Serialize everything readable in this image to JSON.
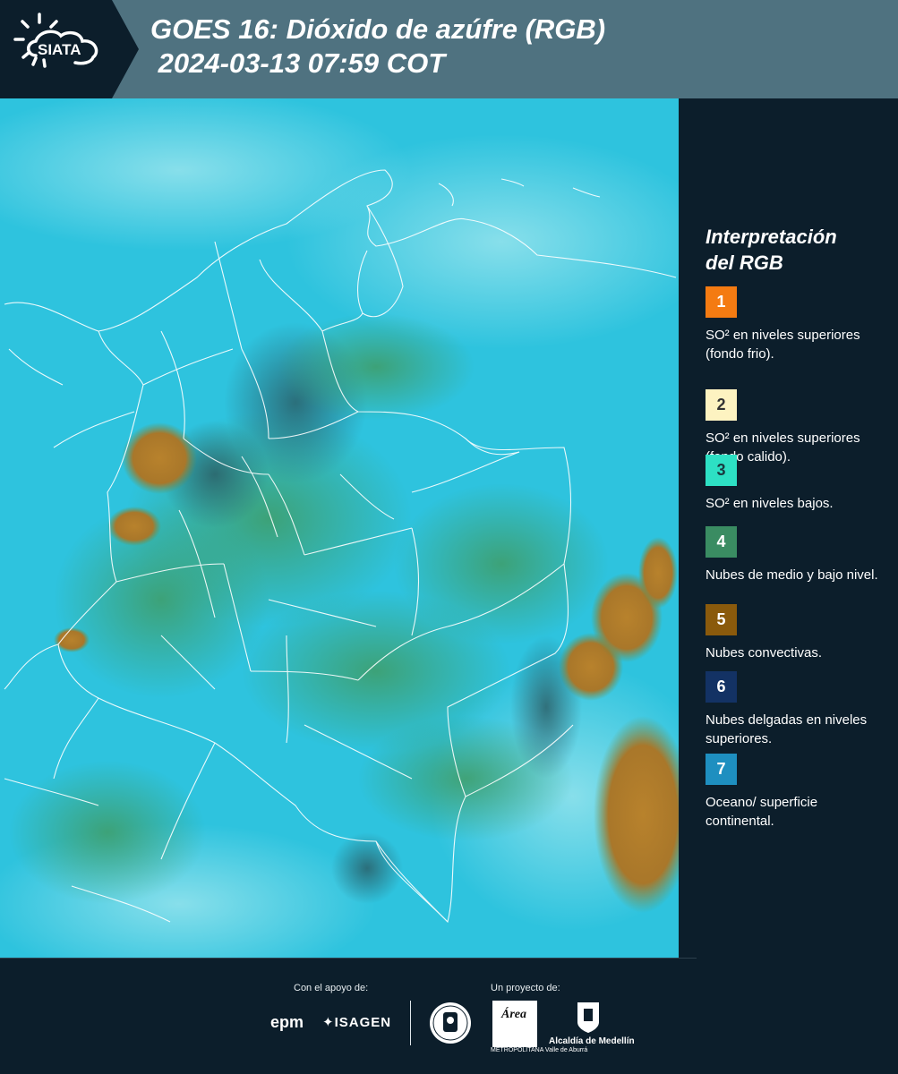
{
  "header": {
    "logo_text": "SIATA",
    "title_line1": "GOES 16: Dióxido de azúfre (RGB)",
    "title_line2": " 2024-03-13 07:59 COT",
    "background_color": "#4f7280",
    "logo_panel_color": "#0c1e2b"
  },
  "legend": {
    "title_line1": "Interpretación",
    "title_line2": "del RGB",
    "items": [
      {
        "number": "1",
        "color": "#f47b12",
        "number_color": "#ffffff",
        "description": "SO² en niveles superiores (fondo frio)."
      },
      {
        "number": "2",
        "color": "#fdf3c1",
        "number_color": "#333333",
        "description": "SO² en niveles superiores (fondo calido)."
      },
      {
        "number": "3",
        "color": "#2de0c4",
        "number_color": "#1a3a40",
        "description": "SO² en niveles bajos."
      },
      {
        "number": "4",
        "color": "#3a8c62",
        "number_color": "#ffffff",
        "description": "Nubes de medio y bajo nivel."
      },
      {
        "number": "5",
        "color": "#8a5a0c",
        "number_color": "#ffffff",
        "description": "Nubes convectivas."
      },
      {
        "number": "6",
        "color": "#133264",
        "number_color": "#ffffff",
        "description": "Nubes delgadas en niveles superiores."
      },
      {
        "number": "7",
        "color": "#1e8fc0",
        "number_color": "#ffffff",
        "description": "Oceano/ superficie continental."
      }
    ]
  },
  "footer": {
    "support_label": "Con el apoyo de:",
    "project_label": "Un proyecto de:",
    "support_logos": [
      "epm",
      "ISAGEN"
    ],
    "project_logos": [
      "Área Metropolitana Valle de Aburrá",
      "Alcaldía de Medellín"
    ],
    "epm_text": "epm",
    "isagen_text": "ISAGEN",
    "area_word": "Área",
    "area_subtitle": "METROPOLITANA Valle de Aburrá",
    "alcaldia_text": "Alcaldía de Medellín"
  },
  "map": {
    "ocean_color": "#2fc5e0",
    "land_color": "#52a9b8",
    "cloud_green": "#3e9a6a",
    "convective_color": "#b27a2a",
    "border_color": "#ffffff"
  }
}
